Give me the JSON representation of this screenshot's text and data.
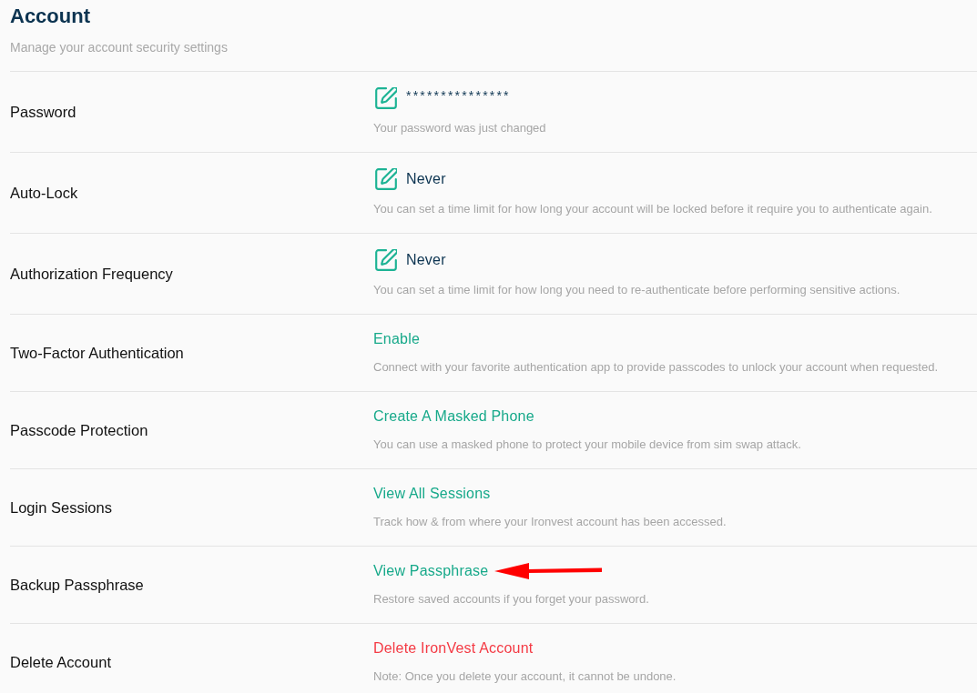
{
  "header": {
    "title": "Account",
    "subtitle": "Manage your account security settings"
  },
  "settings": [
    {
      "label": "Password",
      "kind": "secret",
      "value": "***************",
      "description": "Your password was just changed",
      "annotated": false
    },
    {
      "label": "Auto-Lock",
      "kind": "edit",
      "value": "Never",
      "description": "You can set a time limit for how long your account will be locked before it require you to authenticate again.",
      "annotated": false
    },
    {
      "label": "Authorization Frequency",
      "kind": "edit",
      "value": "Never",
      "description": "You can set a time limit for how long you need to re-authenticate before performing sensitive actions.",
      "annotated": false
    },
    {
      "label": "Two-Factor Authentication",
      "kind": "link",
      "value": "Enable",
      "description": "Connect with your favorite authentication app to provide passcodes to unlock your account when requested.",
      "annotated": false
    },
    {
      "label": "Passcode Protection",
      "kind": "link",
      "value": "Create A Masked Phone",
      "description": "You can use a masked phone to protect your mobile device from sim swap attack.",
      "annotated": false
    },
    {
      "label": "Login Sessions",
      "kind": "link",
      "value": "View All Sessions",
      "description": "Track how & from where your Ironvest account has been accessed.",
      "annotated": false
    },
    {
      "label": "Backup Passphrase",
      "kind": "link",
      "value": "View Passphrase",
      "description": "Restore saved accounts if you forget your password.",
      "annotated": true
    },
    {
      "label": "Delete Account",
      "kind": "danger",
      "value": "Delete IronVest Account",
      "description": "Note: Once you delete your account, it cannot be undone.",
      "annotated": false
    }
  ]
}
